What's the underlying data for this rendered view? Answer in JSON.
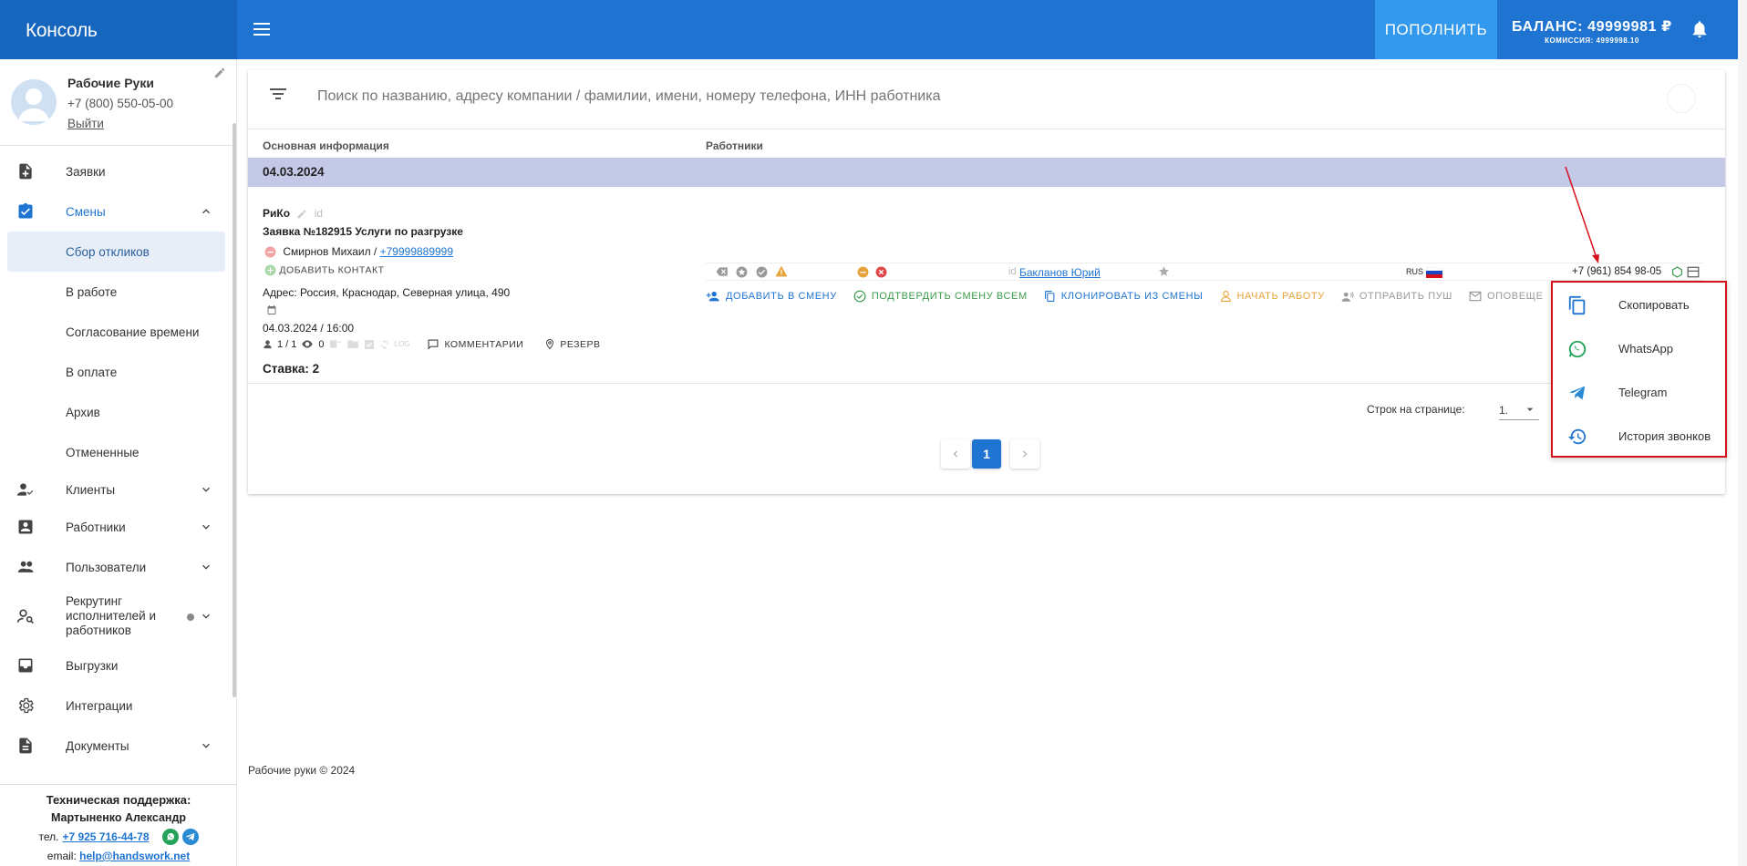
{
  "header": {
    "brand": "Консоль",
    "topup_label": "ПОПОЛНИТЬ",
    "balance": "БАЛАНС: 49999981 ₽",
    "commission": "КОМИССИЯ: 4999998.10"
  },
  "profile": {
    "name": "Рабочие Руки",
    "phone": "+7 (800) 550-05-00",
    "logout": "Выйти"
  },
  "sidebar": {
    "orders": "Заявки",
    "shifts": "Смены",
    "shifts_sub": [
      "Сбор откликов",
      "В работе",
      "Согласование времени",
      "В оплате",
      "Архив",
      "Отмененные"
    ],
    "clients": "Клиенты",
    "workers": "Работники",
    "users": "Пользователи",
    "recruiting": "Рекрутинг исполнителей и работников",
    "exports": "Выгрузки",
    "integrations": "Интеграции",
    "documents": "Документы"
  },
  "support": {
    "title": "Техническая поддержка:",
    "name": "Мартыненко Александр",
    "tel_prefix": "тел.",
    "tel": "+7 925 716-44-78",
    "email_prefix": "email:",
    "email": "help@handswork.net"
  },
  "search": {
    "placeholder": "Поиск по названию, адресу компании / фамилии, имени, номеру телефона, ИНН работника"
  },
  "table": {
    "col_main": "Основная информация",
    "col_workers": "Работники",
    "date_group": "04.03.2024"
  },
  "shift": {
    "company": "РиКо",
    "id_label": "id",
    "order": "Заявка №182915 Услуги по разгрузке",
    "contact_name": "Смирнов Михаил /",
    "contact_phone": "+79999889999",
    "add_contact": "ДОБАВИТЬ КОНТАКТ",
    "address": "Адрес: Россия, Краснодар, Северная улица, 490",
    "datetime": "04.03.2024 / 16:00",
    "workers_count": "1 / 1",
    "views": "0",
    "log": "LOG",
    "comments": "КОММЕНТАРИИ",
    "reserve": "РЕЗЕРВ",
    "rate": "Ставка: 2"
  },
  "worker": {
    "id_label": "id",
    "name": "Бакланов Юрий",
    "country": "RUS",
    "phone": "+7 (961) 854 98-05"
  },
  "actions": {
    "add_to_shift": "ДОБАВИТЬ В СМЕНУ",
    "confirm_all": "ПОДТВЕРДИТЬ СМЕНУ ВСЕМ",
    "clone": "КЛОНИРОВАТЬ ИЗ СМЕНЫ",
    "start_work": "НАЧАТЬ РАБОТУ",
    "send_push": "ОТПРАВИТЬ ПУШ",
    "notify": "ОПОВЕЩЕ"
  },
  "pagination": {
    "rows_label": "Строк на странице:",
    "rows_value": "1.",
    "current_page": "1"
  },
  "footer": "Рабочие руки © 2024",
  "context_menu": {
    "copy": "Скопировать",
    "whatsapp": "WhatsApp",
    "telegram": "Telegram",
    "call_history": "История звонков"
  },
  "colors": {
    "primary": "#1e74d0",
    "brand_bg": "#1666be",
    "topup_bg": "#3399ee",
    "date_band": "#c4c9e8",
    "highlight_red": "#d6111c",
    "whatsapp": "#25a35a",
    "telegram": "#2a8bd4",
    "warning": "#e8a33a",
    "danger": "#e04848"
  }
}
